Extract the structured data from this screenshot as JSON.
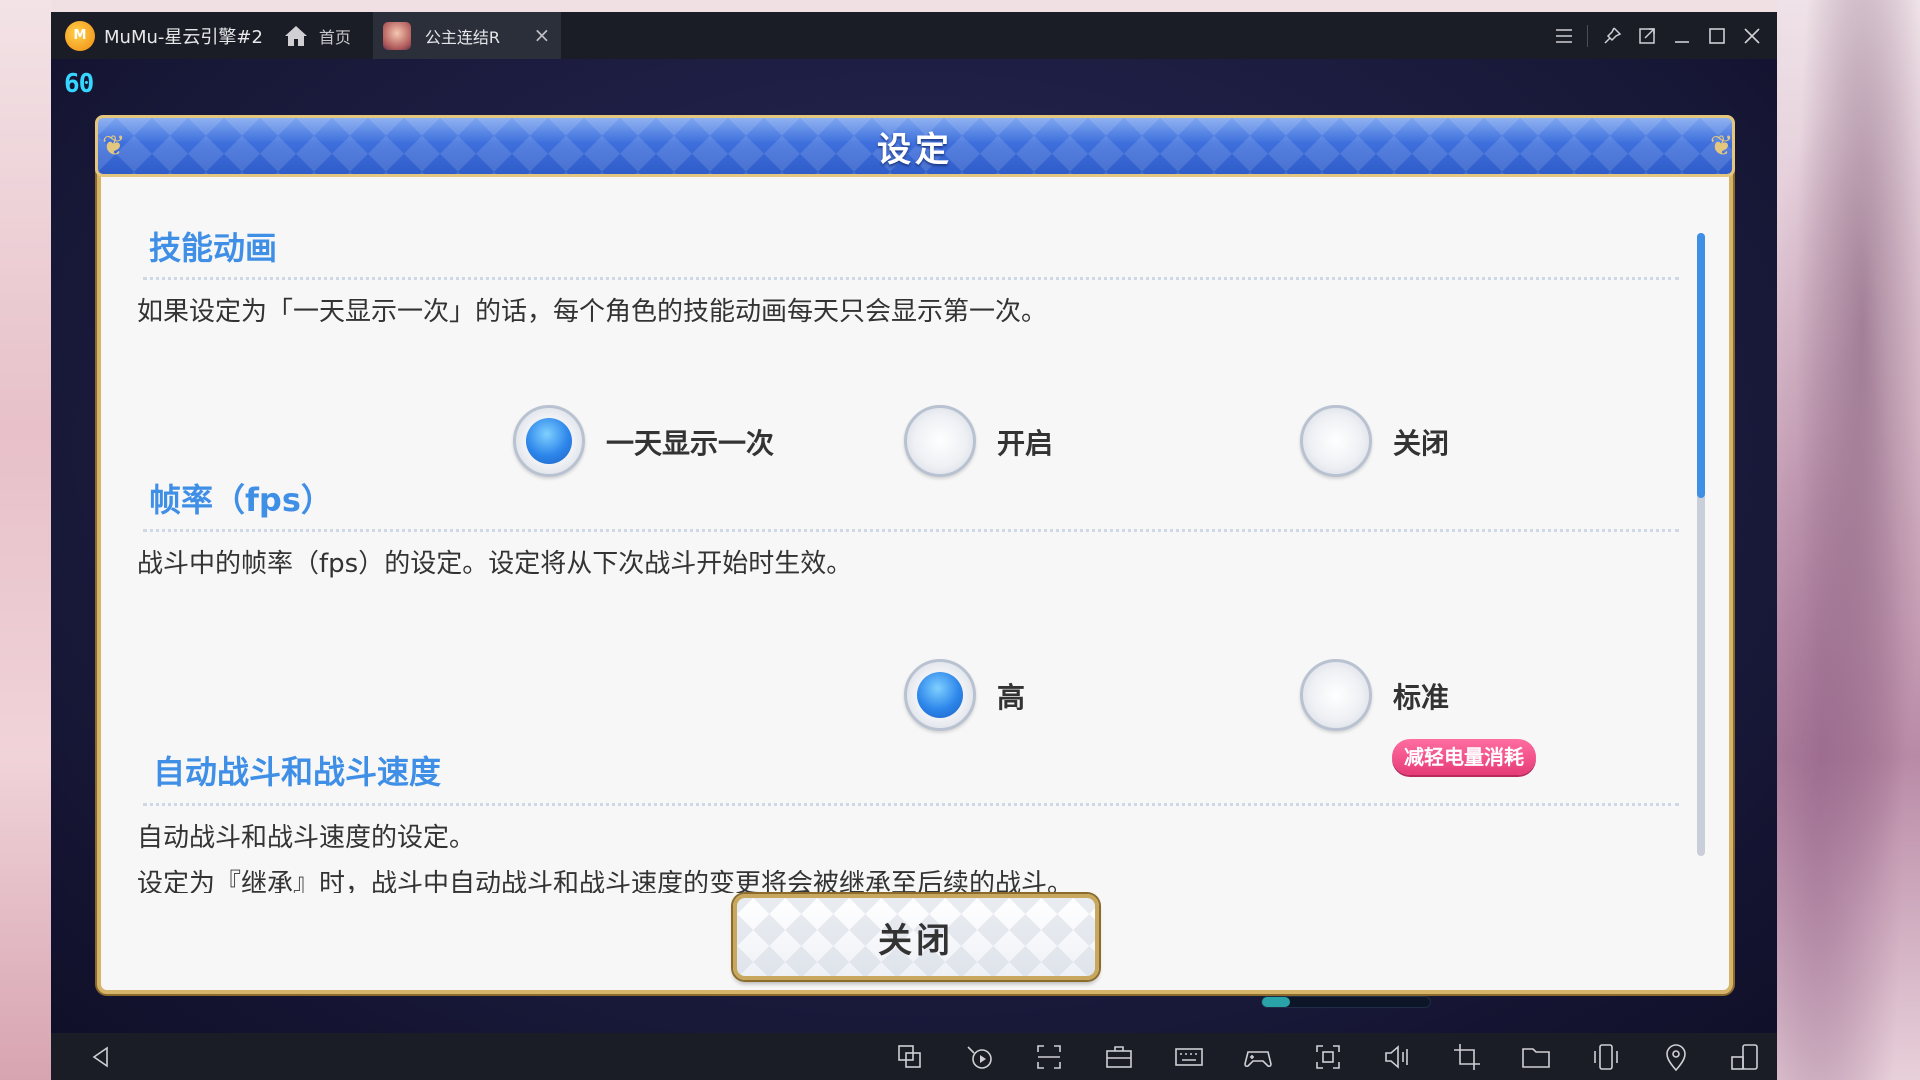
{
  "window": {
    "app_title": "MuMu-星云引擎#2",
    "home_label": "首页",
    "tab_label": "公主连结R",
    "fps": "60"
  },
  "dialog": {
    "title": "设定",
    "sections": [
      {
        "title": "技能动画",
        "description": "如果设定为「一天显示一次」的话，每个角色的技能动画每天只会显示第一次。",
        "options": [
          {
            "label": "一天显示一次",
            "selected": true
          },
          {
            "label": "开启",
            "selected": false
          },
          {
            "label": "关闭",
            "selected": false
          }
        ]
      },
      {
        "title": "帧率（fps）",
        "description": "战斗中的帧率（fps）的设定。设定将从下次战斗开始时生效。",
        "options": [
          {
            "label": "高",
            "selected": true
          },
          {
            "label": "标准",
            "selected": false
          }
        ],
        "badge": "减轻电量消耗"
      },
      {
        "title": "自动战斗和战斗速度",
        "description": "自动战斗和战斗速度的设定。",
        "description_2": "设定为『继承』时，战斗中自动战斗和战斗速度的变更将会被继承至后续的战斗。"
      }
    ],
    "close_label": "关闭"
  },
  "colors": {
    "accent": "#3f8fe6",
    "header": "#3e6fdc",
    "gold": "#d6b56a",
    "badge": "#e63b77"
  }
}
